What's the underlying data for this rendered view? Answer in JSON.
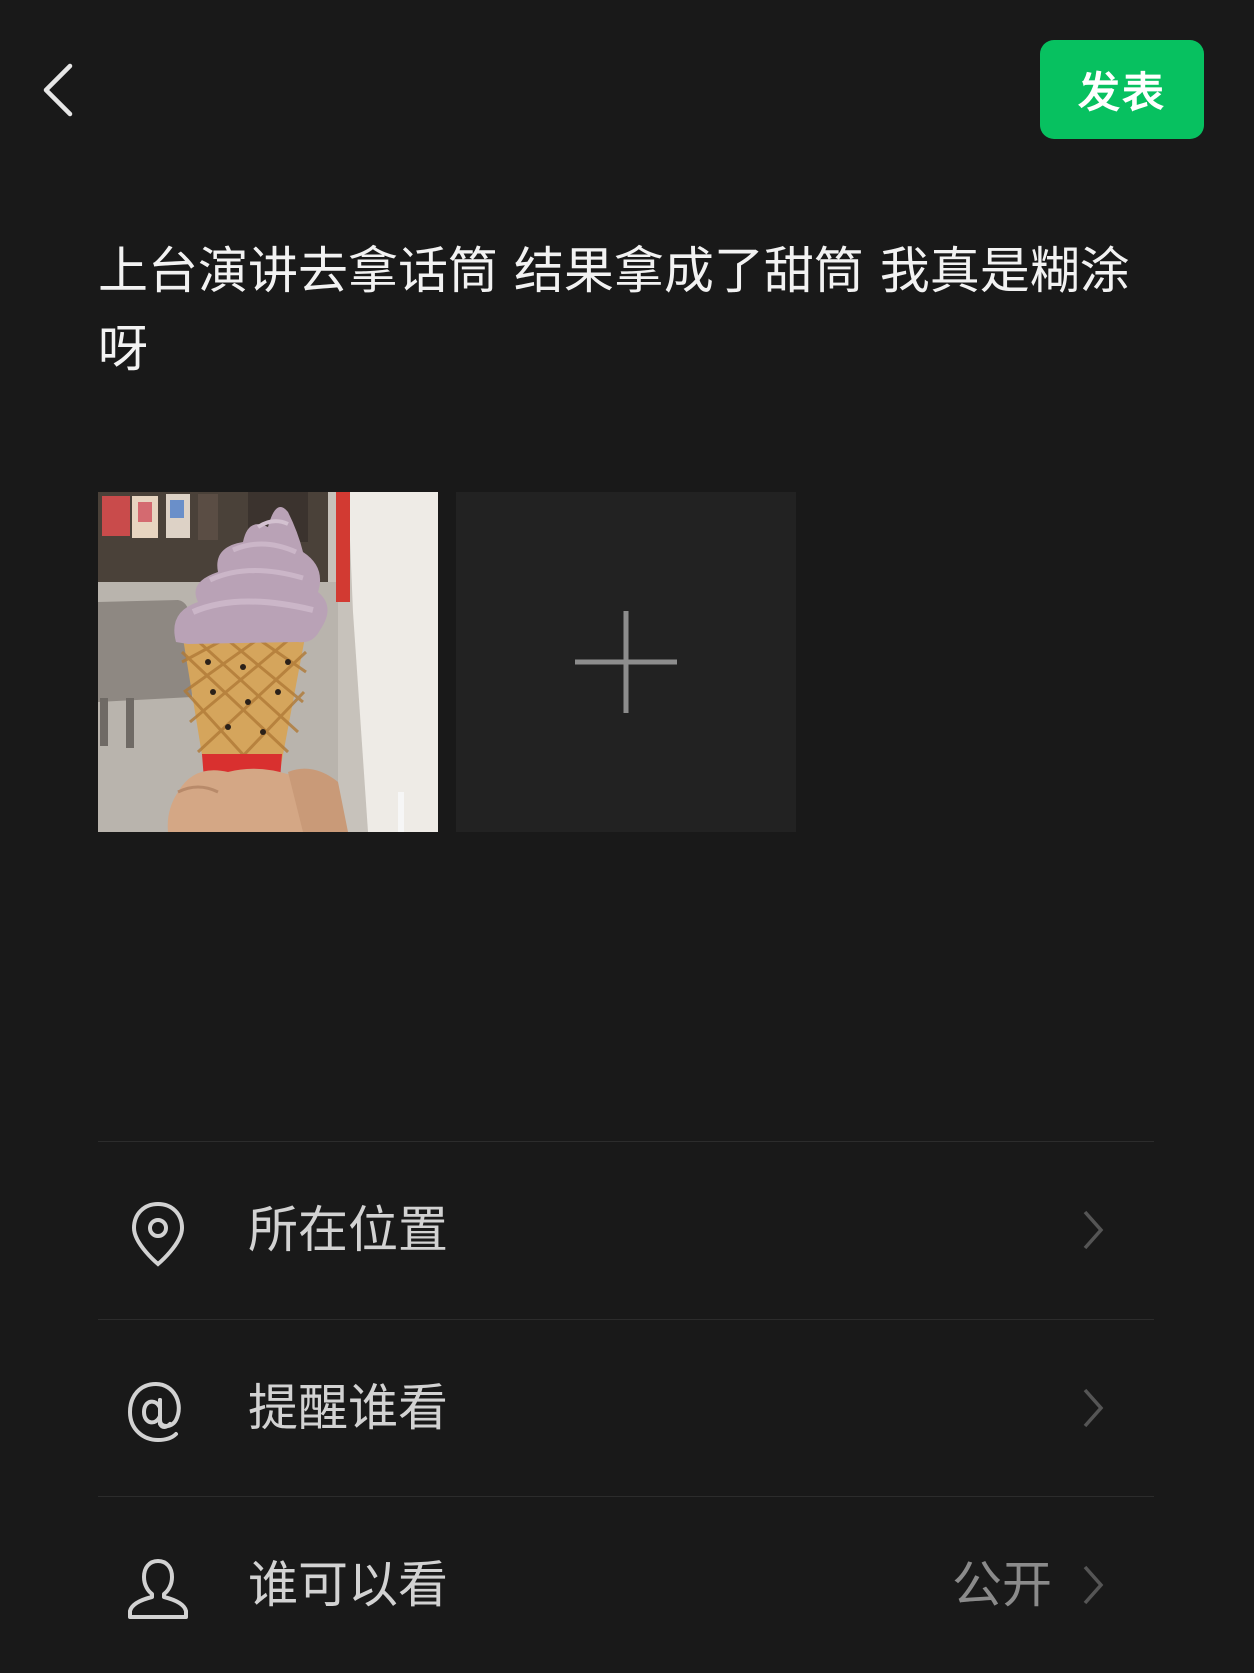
{
  "header": {
    "back_icon": "chevron-left-icon",
    "publish_label": "发表"
  },
  "post": {
    "text": "上台演讲去拿话筒 结果拿成了甜筒 我真是糊涂呀"
  },
  "photos": {
    "add_icon": "plus-icon"
  },
  "menu": {
    "location": {
      "icon": "location-pin-icon",
      "label": "所在位置"
    },
    "mention": {
      "icon": "at-icon",
      "label": "提醒谁看"
    },
    "visibility": {
      "icon": "person-icon",
      "label": "谁可以看",
      "value": "公开"
    }
  },
  "colors": {
    "background": "#191919",
    "accent": "#07c160",
    "text": "#ffffff",
    "muted": "#8b8b8b"
  }
}
